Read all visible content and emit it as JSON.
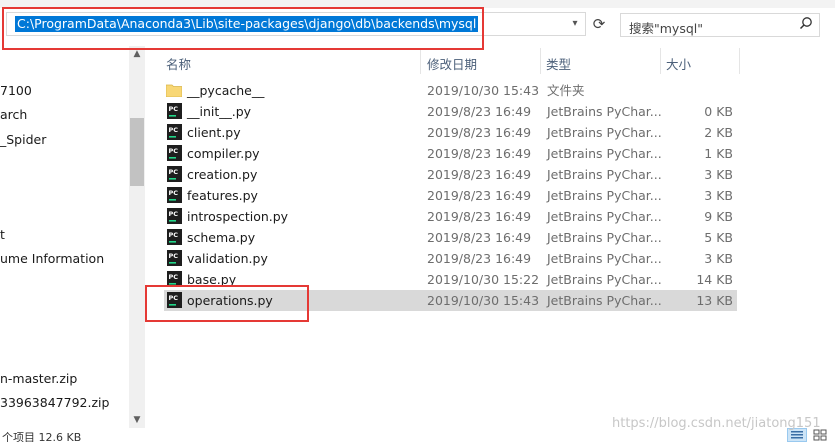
{
  "address_bar": {
    "path": "C:\\ProgramData\\Anaconda3\\Lib\\site-packages\\django\\db\\backends\\mysql",
    "dropdown_icon": "chevron-down-icon"
  },
  "refresh": {
    "icon": "refresh-icon",
    "glyph": "⟳"
  },
  "search": {
    "placeholder": "搜索\"mysql\"",
    "icon": "magnifier-icon",
    "glyph": "🔍"
  },
  "nav_pane": {
    "items": [
      {
        "label": "7100"
      },
      {
        "label": "arch"
      },
      {
        "label": "_Spider"
      },
      {
        "label": "t"
      },
      {
        "label": "ume Information"
      },
      {
        "label": "n-master.zip"
      },
      {
        "label": "33963847792.zip"
      }
    ]
  },
  "columns": {
    "name": "名称",
    "date": "修改日期",
    "type": "类型",
    "size": "大小"
  },
  "files": [
    {
      "name": "__pycache__",
      "date": "2019/10/30 15:43",
      "type": "文件夹",
      "size": "",
      "kind": "folder"
    },
    {
      "name": "__init__.py",
      "date": "2019/8/23 16:49",
      "type": "JetBrains PyChar...",
      "size": "0 KB",
      "kind": "py"
    },
    {
      "name": "client.py",
      "date": "2019/8/23 16:49",
      "type": "JetBrains PyChar...",
      "size": "2 KB",
      "kind": "py"
    },
    {
      "name": "compiler.py",
      "date": "2019/8/23 16:49",
      "type": "JetBrains PyChar...",
      "size": "1 KB",
      "kind": "py"
    },
    {
      "name": "creation.py",
      "date": "2019/8/23 16:49",
      "type": "JetBrains PyChar...",
      "size": "3 KB",
      "kind": "py"
    },
    {
      "name": "features.py",
      "date": "2019/8/23 16:49",
      "type": "JetBrains PyChar...",
      "size": "3 KB",
      "kind": "py"
    },
    {
      "name": "introspection.py",
      "date": "2019/8/23 16:49",
      "type": "JetBrains PyChar...",
      "size": "9 KB",
      "kind": "py"
    },
    {
      "name": "schema.py",
      "date": "2019/8/23 16:49",
      "type": "JetBrains PyChar...",
      "size": "5 KB",
      "kind": "py"
    },
    {
      "name": "validation.py",
      "date": "2019/8/23 16:49",
      "type": "JetBrains PyChar...",
      "size": "3 KB",
      "kind": "py"
    },
    {
      "name": "base.py",
      "date": "2019/10/30 15:22",
      "type": "JetBrains PyChar...",
      "size": "14 KB",
      "kind": "py"
    },
    {
      "name": "operations.py",
      "date": "2019/10/30 15:43",
      "type": "JetBrains PyChar...",
      "size": "13 KB",
      "kind": "py",
      "selected": true
    }
  ],
  "status_bar": {
    "text": "个项目 12.6 KB"
  },
  "watermark": "https://blog.csdn.net/jiatong151",
  "colors": {
    "selection": "#d9d9d9",
    "address_highlight": "#0078d7",
    "annotation_red": "#e53935",
    "pycharm_icon_bg": "#1e1e1e",
    "pycharm_icon_bar": "#21d789",
    "folder": "#f8d775"
  }
}
